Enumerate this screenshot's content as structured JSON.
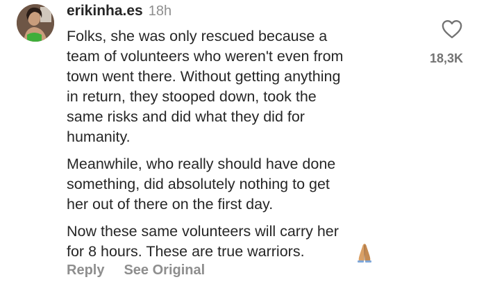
{
  "comment": {
    "username": "erikinha.es",
    "timestamp": "18h",
    "paragraphs": [
      "Folks, she was only rescued because a\nteam of volunteers who weren't even from\ntown went there. Without getting anything\nin return, they stooped down, took the\nsame risks and did what they did for\nhumanity.",
      "Meanwhile, who really should have done\nsomething, did absolutely nothing to get\nher out of there on the first day.",
      "Now these same volunteers will carry her\nfor 8 hours. These are true warriors."
    ],
    "emoji": "folded-hands",
    "like_count": "18,3K",
    "reply_label": "Reply",
    "see_original_label": "See Original"
  },
  "icons": {
    "like": "heart-icon",
    "reaction": "folded-hands-icon"
  },
  "colors": {
    "text": "#262626",
    "secondary": "#8e8e8e",
    "background": "#ffffff"
  }
}
